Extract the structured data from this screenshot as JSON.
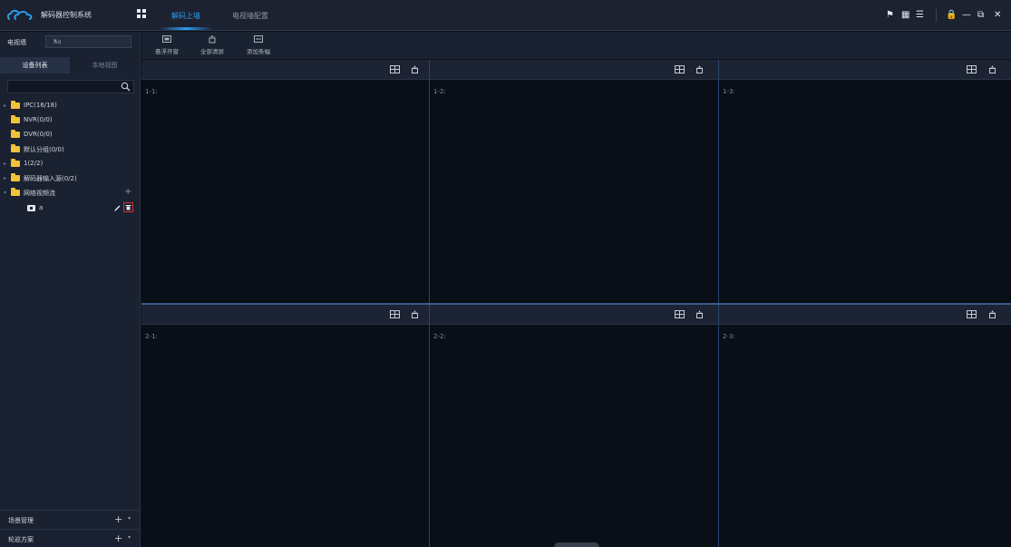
{
  "app": {
    "title": "解码器控制系统",
    "tabs": [
      {
        "label": "解码上墙",
        "active": true
      },
      {
        "label": "电视墙配置",
        "active": false
      }
    ]
  },
  "sidebar": {
    "wall_label": "电视墙",
    "wall_value": "aa",
    "tabs": [
      "设备列表",
      "本地视图"
    ],
    "tree": [
      {
        "label": "IPC(16/18)",
        "expandable": true
      },
      {
        "label": "NVR(0/0)",
        "expandable": false
      },
      {
        "label": "DVR(0/0)",
        "expandable": false
      },
      {
        "label": "默认分组(0/0)",
        "expandable": false
      },
      {
        "label": "1(2/2)",
        "expandable": true
      },
      {
        "label": "解码器输入源(0/2)",
        "expandable": true
      },
      {
        "label": "网络视频流",
        "expandable": true,
        "expanded": true,
        "add": "+"
      }
    ],
    "stream": {
      "label": "a"
    },
    "bottom": [
      {
        "label": "场景管理",
        "plus": "+",
        "caret": "▾"
      },
      {
        "label": "轮巡方案",
        "plus": "+",
        "caret": "▾"
      }
    ]
  },
  "toolbar": {
    "buttons": [
      {
        "label": "悬浮开窗",
        "icon": "float-window-icon"
      },
      {
        "label": "全部清屏",
        "icon": "clear-all-icon"
      },
      {
        "label": "添加条幅",
        "icon": "add-banner-icon"
      }
    ]
  },
  "grid": {
    "cells": [
      "1-1:",
      "1-2:",
      "1-3:",
      "2-1:",
      "2-2:",
      "2-3:"
    ]
  },
  "colors": {
    "accent": "#2d9bf0",
    "delete_highlight": "#e0312e",
    "folder": "#f2c23a"
  }
}
